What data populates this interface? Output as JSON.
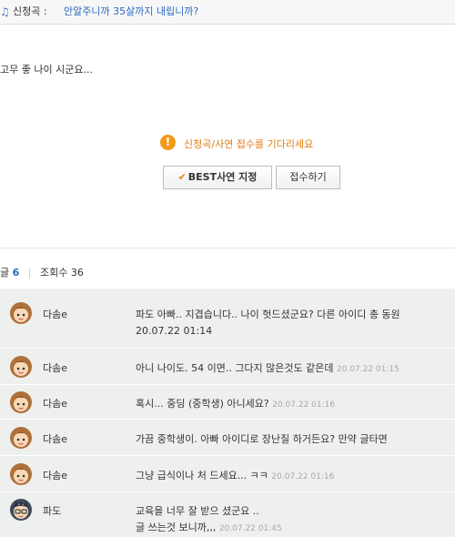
{
  "header": {
    "icon": "music-note-icon",
    "request_label": "신청곡 : ",
    "song_title": "안알주니까 35살까지 내립니까?"
  },
  "post": {
    "body": "고무 좋 나이 시군요..."
  },
  "notice": {
    "icon": "warning-icon",
    "message": "신청곡/사연 접수를 기다리세요"
  },
  "buttons": {
    "best_label": "BEST사연 지정",
    "apply_label": "접수하기"
  },
  "stats": {
    "comments_label": "글",
    "comments_count": "6",
    "views_label": "조회수",
    "views_count": "36"
  },
  "comments": [
    {
      "author": "다솜e",
      "text": "파도 아빠.. 지겹습니다.. 나이 헛드셨군요? 다른 아이디 총 동원",
      "time": "20.07.22 01:14",
      "avatar": "girl-avatar-icon"
    },
    {
      "author": "다솜e",
      "text": "아니 나이도. 54 이면.. 그다지 많은것도 같은데",
      "time": "20.07.22 01:15",
      "avatar": "girl-avatar-icon"
    },
    {
      "author": "다솜e",
      "text": "혹시... 중딩 (중학생) 아니세요?",
      "time": "20.07.22 01:16",
      "avatar": "girl-avatar-icon"
    },
    {
      "author": "다솜e",
      "text": "가끔 중학생이. 아빠 아이디로 장난질 하거든요? 만약 글타면",
      "time": "",
      "avatar": "girl-avatar-icon"
    },
    {
      "author": "다솜e",
      "text": "그냥 급식이나 처 드세요... ㅋㅋ",
      "time": "20.07.22 01:16",
      "avatar": "girl-avatar-icon"
    },
    {
      "author": "파도",
      "text": "교육을 너무 잘 받으 셨군요 ..",
      "text2": "글 쓰는것 보니까,,,",
      "time": "20.07.22 01:45",
      "avatar": "boy-avatar-icon"
    }
  ]
}
